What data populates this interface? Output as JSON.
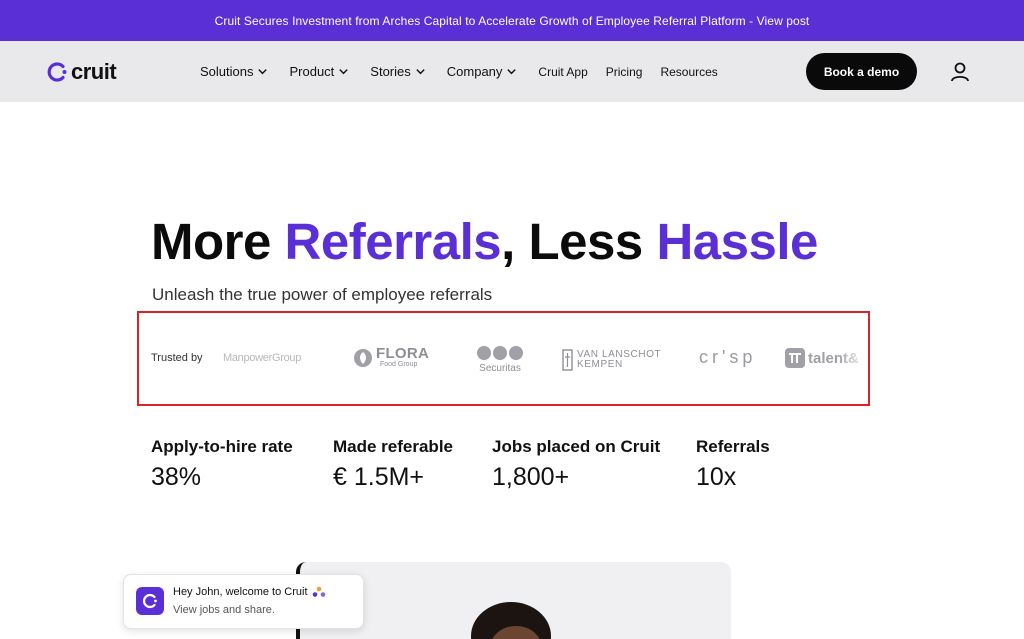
{
  "announcement": "Cruit Secures Investment from Arches Capital to Accelerate Growth of Employee Referral Platform - View post",
  "brand": {
    "name": "cruit",
    "accent": "#5a2fd6"
  },
  "nav": {
    "items": [
      {
        "label": "Solutions",
        "dropdown": true
      },
      {
        "label": "Product",
        "dropdown": true
      },
      {
        "label": "Stories",
        "dropdown": true
      },
      {
        "label": "Company",
        "dropdown": true
      },
      {
        "label": "Cruit App",
        "dropdown": false
      },
      {
        "label": "Pricing",
        "dropdown": false
      },
      {
        "label": "Resources",
        "dropdown": false
      }
    ],
    "cta": "Book a demo",
    "account_icon": "user-icon"
  },
  "hero": {
    "title_part1": "More ",
    "title_accent1": "Referrals",
    "title_part2": ", Less ",
    "title_accent2": "Hassle",
    "subtitle": "Unleash the true power of employee referrals"
  },
  "trusted": {
    "label": "Trusted by",
    "logos": {
      "manpower": "ManpowerGroup",
      "flora_main": "FLORA",
      "flora_sub": "Food Group",
      "securitas": "Securitas",
      "vanl_line1": "VAN LANSCHOT",
      "vanl_line2": "KEMPEN",
      "crisp": "cr'sp",
      "talent": "talent&"
    }
  },
  "stats": [
    {
      "label": "Apply-to-hire rate",
      "value": "38%"
    },
    {
      "label": "Made referable",
      "value": "€ 1.5M+"
    },
    {
      "label": "Jobs placed on Cruit",
      "value": "1,800+"
    },
    {
      "label": "Referrals",
      "value": "10x"
    }
  ],
  "toast": {
    "title": "Hey John, welcome to Cruit",
    "text": "View jobs and share."
  }
}
